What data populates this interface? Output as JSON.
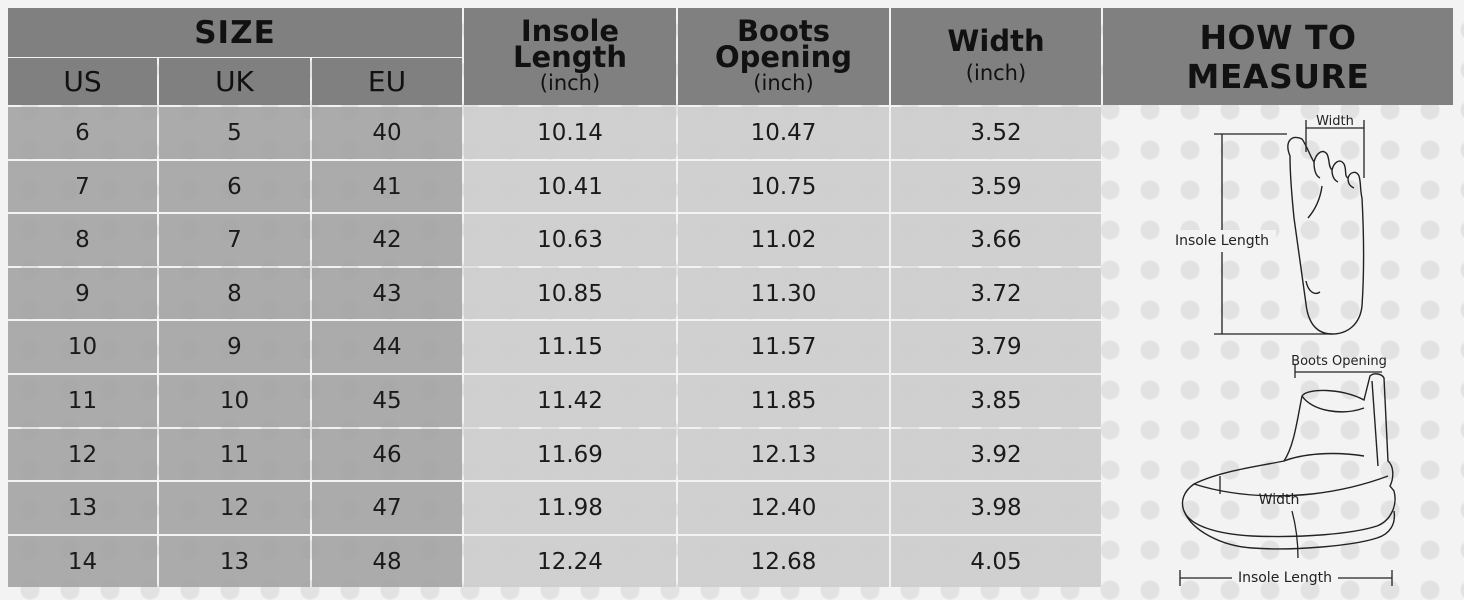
{
  "header": {
    "size": "SIZE",
    "us": "US",
    "uk": "UK",
    "eu": "EU",
    "insole_line1": "Insole",
    "insole_line2": "Length",
    "insole_unit": "(inch)",
    "opening_line1": "Boots",
    "opening_line2": "Opening",
    "opening_unit": "(inch)",
    "width": "Width",
    "width_unit": "(inch)",
    "how_to_measure": "HOW TO MEASURE"
  },
  "rows": [
    {
      "us": "6",
      "uk": "5",
      "eu": "40",
      "insole": "10.14",
      "opening": "10.47",
      "width": "3.52"
    },
    {
      "us": "7",
      "uk": "6",
      "eu": "41",
      "insole": "10.41",
      "opening": "10.75",
      "width": "3.59"
    },
    {
      "us": "8",
      "uk": "7",
      "eu": "42",
      "insole": "10.63",
      "opening": "11.02",
      "width": "3.66"
    },
    {
      "us": "9",
      "uk": "8",
      "eu": "43",
      "insole": "10.85",
      "opening": "11.30",
      "width": "3.72"
    },
    {
      "us": "10",
      "uk": "9",
      "eu": "44",
      "insole": "11.15",
      "opening": "11.57",
      "width": "3.79"
    },
    {
      "us": "11",
      "uk": "10",
      "eu": "45",
      "insole": "11.42",
      "opening": "11.85",
      "width": "3.85"
    },
    {
      "us": "12",
      "uk": "11",
      "eu": "46",
      "insole": "11.69",
      "opening": "12.13",
      "width": "3.92"
    },
    {
      "us": "13",
      "uk": "12",
      "eu": "47",
      "insole": "11.98",
      "opening": "12.40",
      "width": "3.98"
    },
    {
      "us": "14",
      "uk": "13",
      "eu": "48",
      "insole": "12.24",
      "opening": "12.68",
      "width": "4.05"
    }
  ],
  "diagram": {
    "foot_width": "Width",
    "foot_insole_length": "Insole Length",
    "boot_opening": "Boots Opening",
    "boot_width": "Width",
    "boot_insole_length": "Insole Length"
  },
  "colors": {
    "header_bg": "#808080",
    "dark_cell": "#a0a0a0",
    "light_cell": "#cdcdcd",
    "background": "#f3f3f3"
  }
}
